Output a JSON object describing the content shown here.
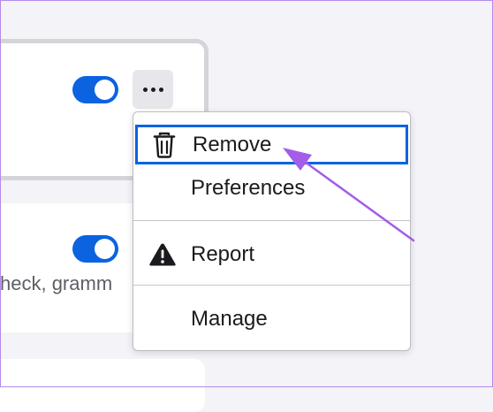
{
  "extension_cards": {
    "top": {
      "toggle_on": true,
      "more_button_label": "more-options"
    },
    "middle": {
      "toggle_on": true,
      "description_fragment": "heck, gramm"
    }
  },
  "context_menu": {
    "items": [
      {
        "label": "Remove",
        "icon": "trash-icon",
        "highlighted": true
      },
      {
        "label": "Preferences",
        "icon": ""
      },
      {
        "label": "Report",
        "icon": "warning-icon"
      },
      {
        "label": "Manage",
        "icon": ""
      }
    ]
  },
  "colors": {
    "accent": "#0b63e0",
    "annotation_arrow": "#a35de8",
    "frame": "#b38bea"
  }
}
